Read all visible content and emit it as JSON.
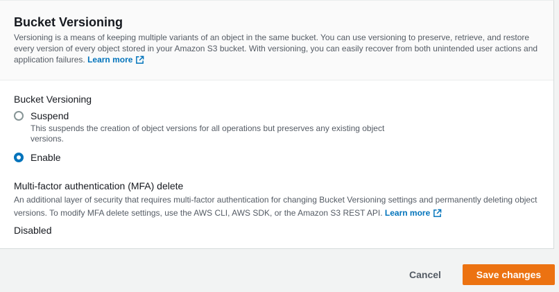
{
  "header": {
    "title": "Bucket Versioning",
    "description": "Versioning is a means of keeping multiple variants of an object in the same bucket. You can use versioning to preserve, retrieve, and restore every version of every object stored in your Amazon S3 bucket. With versioning, you can easily recover from both unintended user actions and application failures.",
    "learn_more": "Learn more"
  },
  "versioning": {
    "label": "Bucket Versioning",
    "selected": "Enable",
    "options": [
      {
        "label": "Suspend",
        "description": "This suspends the creation of object versions for all operations but preserves any existing object versions."
      },
      {
        "label": "Enable"
      }
    ]
  },
  "mfa": {
    "label": "Multi-factor authentication (MFA) delete",
    "description": "An additional layer of security that requires multi-factor authentication for changing Bucket Versioning settings and permanently deleting object versions. To modify MFA delete settings, use the AWS CLI, AWS SDK, or the Amazon S3 REST API.",
    "learn_more": "Learn more",
    "value": "Disabled"
  },
  "footer": {
    "cancel_label": "Cancel",
    "save_label": "Save changes"
  },
  "colors": {
    "link": "#0073bb",
    "primary_button": "#ec7211",
    "radio_selected": "#0073bb"
  },
  "icons": {
    "external_link": "external-link-icon"
  }
}
